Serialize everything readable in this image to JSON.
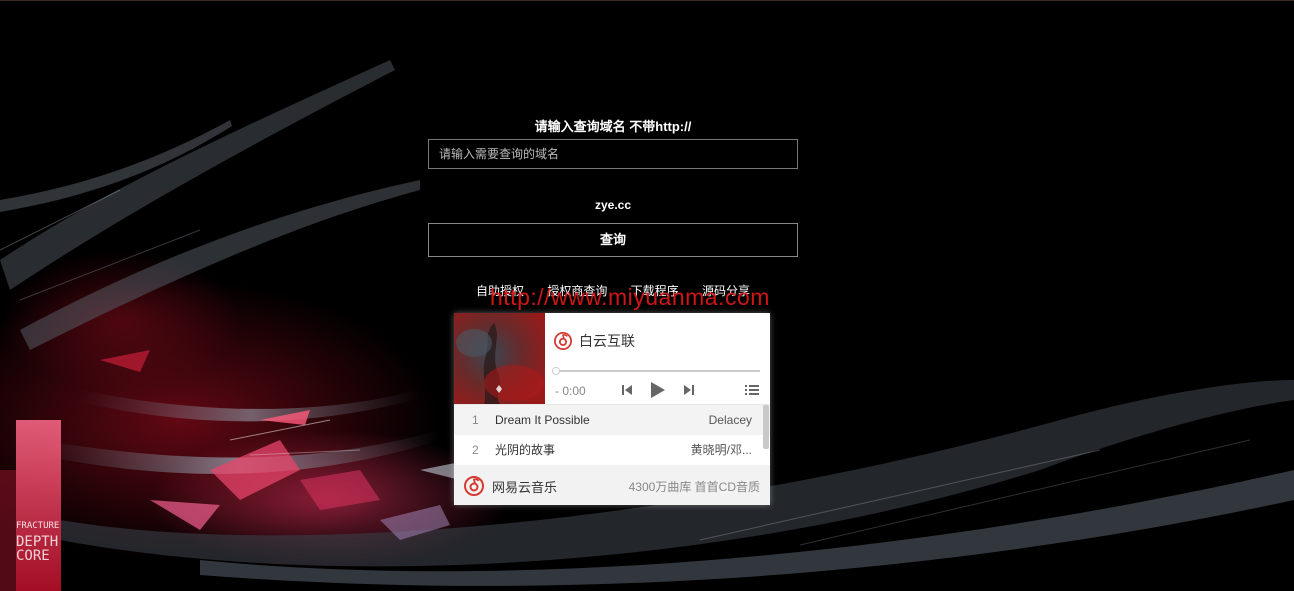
{
  "form": {
    "title": "请输入查询域名 不带http://",
    "input_placeholder": "请输入需要查询的域名",
    "example_domain": "zye.cc",
    "query_button": "查询"
  },
  "links": [
    {
      "label": "自助授权"
    },
    {
      "label": "授权商查询"
    },
    {
      "label": "下载程序"
    },
    {
      "label": "源码分享"
    }
  ],
  "watermark": "http://www.miyuanma.com",
  "player": {
    "song_title": "白云互联",
    "time": "- 0:00",
    "tracks": [
      {
        "num": "1",
        "name": "Dream It Possible",
        "artist": "Delacey"
      },
      {
        "num": "2",
        "name": "光阴的故事",
        "artist": "黄晓明/邓..."
      }
    ],
    "footer_brand": "网易云音乐",
    "footer_slogan": "4300万曲库 首首CD音质"
  },
  "colors": {
    "brand_red": "#d43c33",
    "watermark_red": "#e01818"
  },
  "icons": [
    "netease-music-icon",
    "prev-icon",
    "play-icon",
    "next-icon",
    "playlist-icon"
  ]
}
